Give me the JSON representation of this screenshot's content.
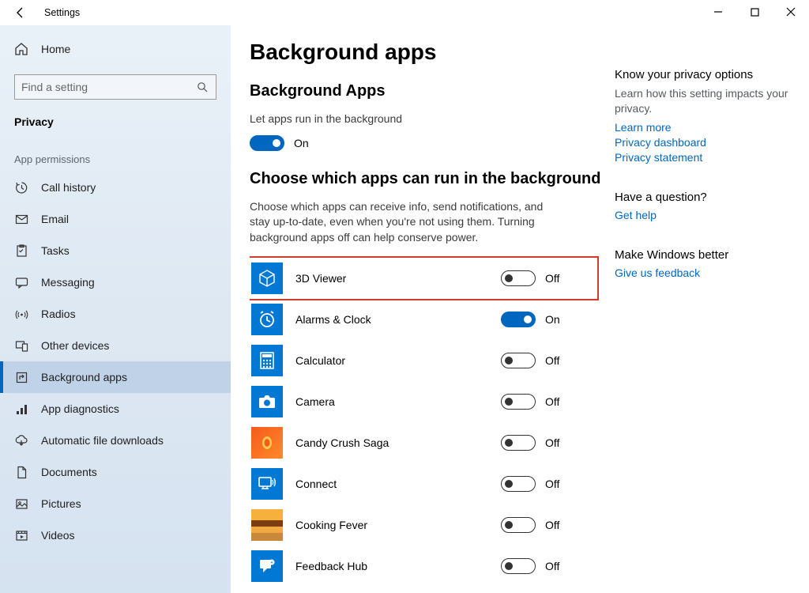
{
  "window": {
    "title": "Settings"
  },
  "sidebar": {
    "home_label": "Home",
    "search_placeholder": "Find a setting",
    "category": "Privacy",
    "section_heading": "App permissions",
    "items": [
      {
        "label": "Call history"
      },
      {
        "label": "Email"
      },
      {
        "label": "Tasks"
      },
      {
        "label": "Messaging"
      },
      {
        "label": "Radios"
      },
      {
        "label": "Other devices"
      },
      {
        "label": "Background apps"
      },
      {
        "label": "App diagnostics"
      },
      {
        "label": "Automatic file downloads"
      },
      {
        "label": "Documents"
      },
      {
        "label": "Pictures"
      },
      {
        "label": "Videos"
      }
    ]
  },
  "page": {
    "title": "Background apps",
    "section1_title": "Background Apps",
    "section1_desc": "Let apps run in the background",
    "master_toggle": {
      "on": true,
      "label": "On"
    },
    "section2_title": "Choose which apps can run in the background",
    "section2_desc": "Choose which apps can receive info, send notifications, and stay up-to-date, even when you're not using them. Turning background apps off can help conserve power.",
    "apps": [
      {
        "name": "3D Viewer",
        "on": false,
        "label": "Off"
      },
      {
        "name": "Alarms & Clock",
        "on": true,
        "label": "On"
      },
      {
        "name": "Calculator",
        "on": false,
        "label": "Off"
      },
      {
        "name": "Camera",
        "on": false,
        "label": "Off"
      },
      {
        "name": "Candy Crush Saga",
        "on": false,
        "label": "Off"
      },
      {
        "name": "Connect",
        "on": false,
        "label": "Off"
      },
      {
        "name": "Cooking Fever",
        "on": false,
        "label": "Off"
      },
      {
        "name": "Feedback Hub",
        "on": false,
        "label": "Off"
      }
    ]
  },
  "right": {
    "privacy_heading": "Know your privacy options",
    "privacy_sub": "Learn how this setting impacts your privacy.",
    "learn_more": "Learn more",
    "dashboard": "Privacy dashboard",
    "statement": "Privacy statement",
    "question_heading": "Have a question?",
    "get_help": "Get help",
    "make_better": "Make Windows better",
    "feedback": "Give us feedback"
  }
}
